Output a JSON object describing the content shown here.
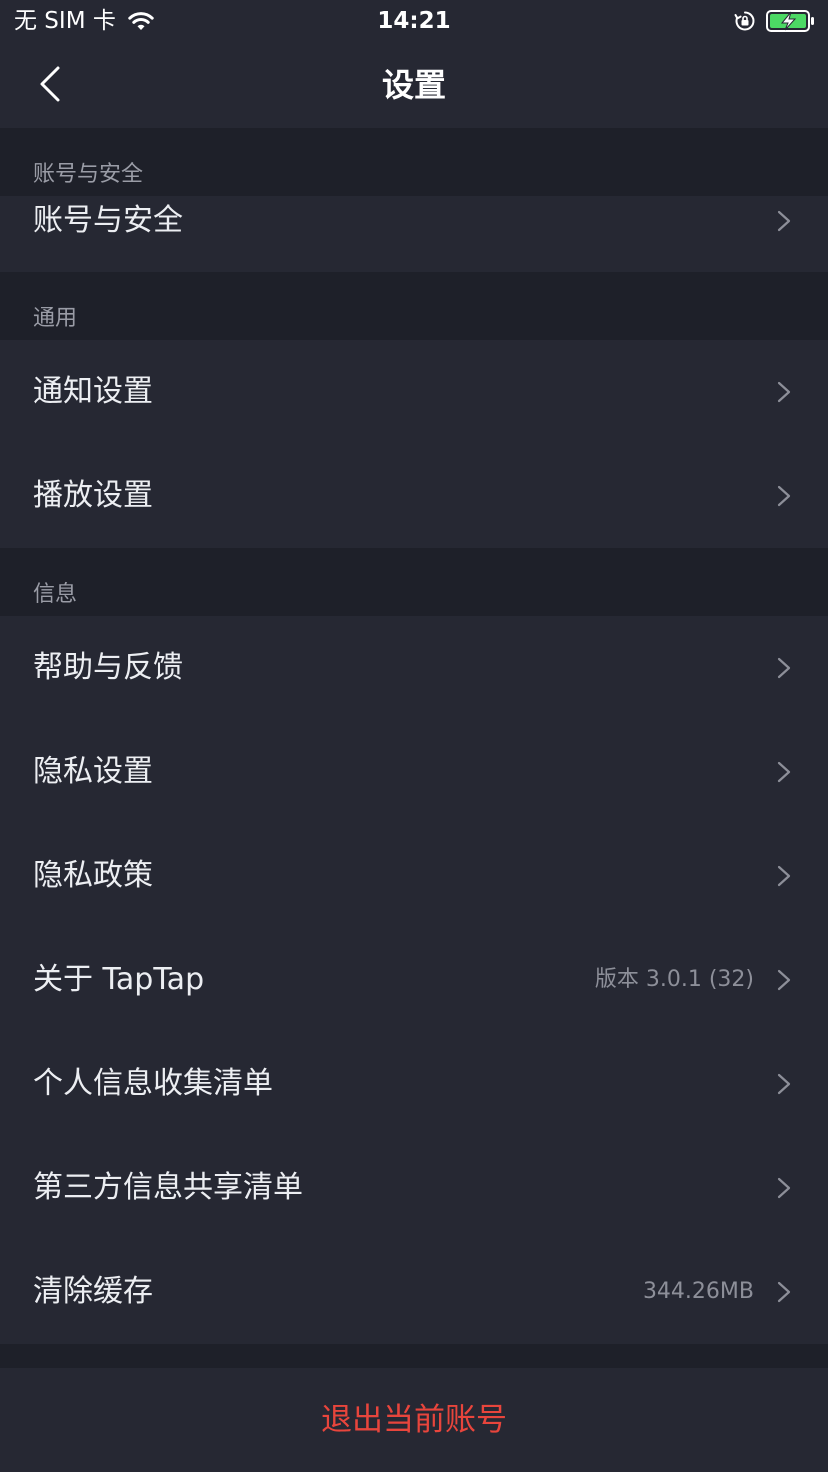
{
  "status_bar": {
    "carrier": "无 SIM 卡",
    "time": "14:21"
  },
  "nav": {
    "title": "设置"
  },
  "sections": [
    {
      "header": "账号与安全",
      "rows": [
        {
          "label": "账号与安全",
          "value": ""
        }
      ]
    },
    {
      "header": "通用",
      "rows": [
        {
          "label": "通知设置",
          "value": ""
        },
        {
          "label": "播放设置",
          "value": ""
        }
      ]
    },
    {
      "header": "信息",
      "rows": [
        {
          "label": "帮助与反馈",
          "value": ""
        },
        {
          "label": "隐私设置",
          "value": ""
        },
        {
          "label": "隐私政策",
          "value": ""
        },
        {
          "label": "关于 TapTap",
          "value": "版本 3.0.1 (32)"
        },
        {
          "label": "个人信息收集清单",
          "value": ""
        },
        {
          "label": "第三方信息共享清单",
          "value": ""
        },
        {
          "label": "清除缓存",
          "value": "344.26MB"
        }
      ]
    }
  ],
  "logout": {
    "label": "退出当前账号"
  },
  "colors": {
    "background": "#1e2029",
    "surface": "#262833",
    "danger": "#e8453c",
    "battery_charge": "#4cd964"
  }
}
